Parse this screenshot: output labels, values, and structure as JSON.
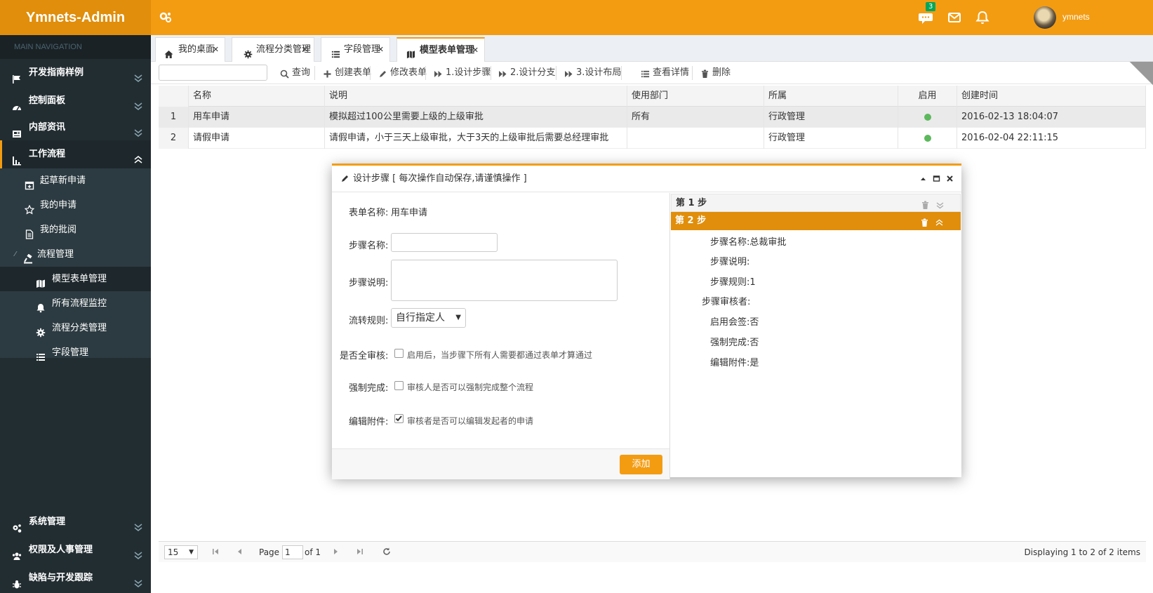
{
  "header": {
    "brand": "Ymnets-Admin",
    "messages_badge": "3",
    "username": "ymnets"
  },
  "sidebar": {
    "nav_header": "MAIN NAVIGATION",
    "items": [
      {
        "label": "开发指南样例",
        "icon": "flag-icon"
      },
      {
        "label": "控制面板",
        "icon": "dashboard-icon"
      },
      {
        "label": "内部资讯",
        "icon": "newspaper-icon"
      },
      {
        "label": "工作流程",
        "icon": "workflow-icon"
      }
    ],
    "workflow_sub": [
      {
        "label": "起草新申请",
        "icon": "calendar-plus-icon"
      },
      {
        "label": "我的申请",
        "icon": "star-icon"
      },
      {
        "label": "我的批阅",
        "icon": "document-icon"
      },
      {
        "label": "流程管理",
        "icon": "gavel-icon"
      }
    ],
    "manage_sub": [
      {
        "label": "模型表单管理",
        "icon": "map-icon"
      },
      {
        "label": "所有流程监控",
        "icon": "bell-icon"
      },
      {
        "label": "流程分类管理",
        "icon": "gear-icon"
      },
      {
        "label": "字段管理",
        "icon": "list-icon"
      }
    ],
    "bottom_items": [
      {
        "label": "系统管理",
        "icon": "cogs-icon"
      },
      {
        "label": "权限及人事管理",
        "icon": "users-icon"
      },
      {
        "label": "缺陷与开发跟踪",
        "icon": "bug-icon"
      }
    ]
  },
  "tabs": [
    {
      "label": "我的桌面",
      "icon": "home-icon"
    },
    {
      "label": "流程分类管理",
      "icon": "gear-icon"
    },
    {
      "label": "字段管理",
      "icon": "list-icon"
    },
    {
      "label": "模型表单管理",
      "icon": "map-icon"
    }
  ],
  "toolbar": {
    "search_value": "",
    "buttons": [
      "查询",
      "创建表单",
      "修改表单",
      "1.设计步骤",
      "2.设计分支",
      "3.设计布局",
      "查看详情",
      "删除"
    ]
  },
  "grid": {
    "columns": [
      "名称",
      "说明",
      "使用部门",
      "所属",
      "启用",
      "创建时间"
    ],
    "rows": [
      {
        "num": "1",
        "name": "用车申请",
        "desc": "模拟超过100公里需要上级的上级审批",
        "dept": "所有",
        "belong": "行政管理",
        "enabled": true,
        "created": "2016-02-13 18:04:07"
      },
      {
        "num": "2",
        "name": "请假申请",
        "desc": "请假申请，小于三天上级审批，大于3天的上级审批后需要总经理审批",
        "dept": "",
        "belong": "行政管理",
        "enabled": true,
        "created": "2016-02-04 22:11:15"
      }
    ],
    "status_color": "#5cb85c"
  },
  "pager": {
    "page_size": "15",
    "page_label": "Page",
    "page_value": "1",
    "of_label": "of 1",
    "display_text": "Displaying 1 to 2 of 2 items"
  },
  "modal": {
    "title": "设计步骤 [ 每次操作自动保存,请谨慎操作 ]",
    "form_name_label": "表单名称:",
    "form_name_value": "用车申请",
    "step_name_label": "步骤名称:",
    "step_name_value": "",
    "step_desc_label": "步骤说明:",
    "step_desc_value": "",
    "flow_rule_label": "流转规则:",
    "flow_rule_value": "自行指定人",
    "all_approve_label": "是否全审核:",
    "all_approve_text": "启用后，当步骤下所有人需要都通过表单才算通过",
    "all_approve_checked": false,
    "force_label": "强制完成:",
    "force_text": "审核人是否可以强制完成整个流程",
    "force_checked": false,
    "edit_attach_label": "编辑附件:",
    "edit_attach_text": "审核者是否可以编辑发起者的申请",
    "edit_attach_checked": true,
    "add_button": "添加",
    "steps": [
      {
        "title": "第 1 步"
      },
      {
        "title": "第 2 步",
        "details": [
          {
            "label": "步骤名称:",
            "value": "总裁审批"
          },
          {
            "label": "步骤说明:",
            "value": ""
          },
          {
            "label": "步骤规则:",
            "value": "1"
          },
          {
            "label": "步骤审核者:",
            "value": ""
          },
          {
            "label": "启用会签:",
            "value": "否"
          },
          {
            "label": "强制完成:",
            "value": "否"
          },
          {
            "label": "编辑附件:",
            "value": "是"
          }
        ]
      }
    ]
  },
  "colors": {
    "accent": "#f39c12",
    "accent_dark": "#e08e0b",
    "sidebar_bg": "#222d32",
    "sidebar_sub_bg": "#2c3b41"
  }
}
